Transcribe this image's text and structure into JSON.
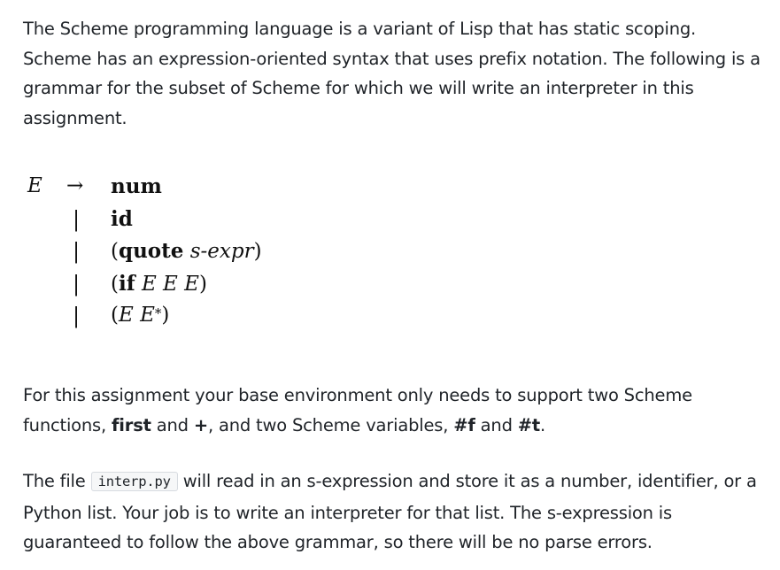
{
  "intro": {
    "text": "The Scheme programming language is a variant of Lisp that has static scoping. Scheme has an expression-oriented syntax that uses prefix notation. The following is a grammar for the subset of Scheme for which we will write an interpreter in this assignment."
  },
  "grammar": {
    "lhs": "E",
    "arrow": "→",
    "bar": "|",
    "rules": [
      {
        "keyword": "num"
      },
      {
        "keyword": "id"
      },
      {
        "open": "(",
        "keyword": "quote",
        "rest": "s-expr",
        "close": ")"
      },
      {
        "open": "(",
        "keyword": "if",
        "rest": "E E E",
        "close": ")"
      },
      {
        "open": "(",
        "rest": "E E",
        "sup": "*",
        "close": ")"
      }
    ]
  },
  "base_env": {
    "text_1": "For this assignment your base environment only needs to support two Scheme functions, ",
    "fn_1": "first",
    "text_2": " and ",
    "fn_2": "+",
    "text_3": ", and two Scheme variables, ",
    "var_1": "#f",
    "text_4": " and ",
    "var_2": "#t",
    "text_5": "."
  },
  "file_para": {
    "text_1": "The file ",
    "filename": "interp.py",
    "text_2": " will read in an s-expression and store it as a number, identifier, or a Python list. Your job is to write an interpreter for that list. The s-expression is guaranteed to follow the above grammar, so there will be no parse errors."
  }
}
